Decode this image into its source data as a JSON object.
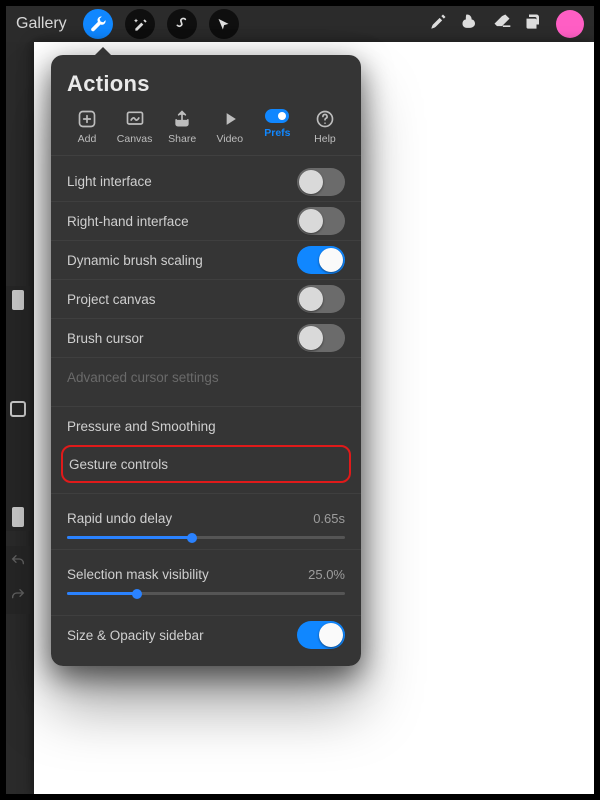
{
  "topbar": {
    "gallery_label": "Gallery",
    "swatch_color": "#ff5ec4"
  },
  "panel": {
    "title": "Actions",
    "tabs": {
      "add": "Add",
      "canvas": "Canvas",
      "share": "Share",
      "video": "Video",
      "prefs": "Prefs",
      "help": "Help"
    },
    "rows": {
      "light_interface": "Light interface",
      "right_hand": "Right-hand interface",
      "dynamic_brush": "Dynamic brush scaling",
      "project_canvas": "Project canvas",
      "brush_cursor": "Brush cursor",
      "advanced_cursor": "Advanced cursor settings",
      "pressure": "Pressure and Smoothing",
      "gesture": "Gesture controls",
      "rapid_undo": "Rapid undo delay",
      "rapid_undo_value": "0.65s",
      "selection_mask": "Selection mask visibility",
      "selection_mask_value": "25.0%",
      "size_opacity": "Size & Opacity sidebar"
    },
    "toggles": {
      "light_interface": false,
      "right_hand": false,
      "dynamic_brush": true,
      "project_canvas": false,
      "brush_cursor": false,
      "size_opacity": true
    },
    "sliders": {
      "rapid_undo_pct": 45,
      "selection_mask_pct": 25
    }
  }
}
